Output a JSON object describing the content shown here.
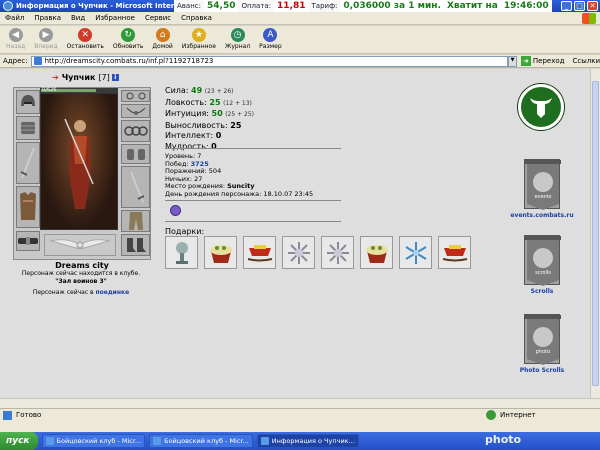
{
  "browser": {
    "title": "Информация о Чупчик - Microsoft Internet Explorer",
    "stats": [
      {
        "label": "Аванс:",
        "value": "54,50",
        "color": "green"
      },
      {
        "label": "Оплата:",
        "value": "11,81",
        "color": "red"
      },
      {
        "label": "Тариф:",
        "value": "0,036000 за 1 мин.",
        "color": "green"
      },
      {
        "label": "Хватит на",
        "value": "19:46:00",
        "color": "green"
      }
    ],
    "menu": [
      "Файл",
      "Правка",
      "Вид",
      "Избранное",
      "Сервис",
      "Справка"
    ],
    "toolbar": [
      {
        "label": "Назад",
        "icon": "back-arrow-icon",
        "enabled": false,
        "color": "#9a9a9a",
        "glyph": "◀"
      },
      {
        "label": "Вперед",
        "icon": "forward-arrow-icon",
        "enabled": false,
        "color": "#9a9a9a",
        "glyph": "▶"
      },
      {
        "label": "Остановить",
        "icon": "stop-icon",
        "enabled": true,
        "color": "#d23a2a",
        "glyph": "✕"
      },
      {
        "label": "Обновить",
        "icon": "refresh-icon",
        "enabled": true,
        "color": "#2e9a3a",
        "glyph": "↻"
      },
      {
        "label": "Домой",
        "icon": "home-icon",
        "enabled": true,
        "color": "#d47a1a",
        "glyph": "⌂"
      },
      {
        "label": "Избранное",
        "icon": "star-icon",
        "enabled": true,
        "color": "#e0b020",
        "glyph": "★"
      },
      {
        "label": "Журнал",
        "icon": "history-icon",
        "enabled": true,
        "color": "#2a8a5a",
        "glyph": "◷"
      },
      {
        "label": "Размер",
        "icon": "text-size-icon",
        "enabled": true,
        "color": "#3a5ac8",
        "glyph": "A"
      }
    ],
    "address_label": "Адрес:",
    "url": "http://dreamscity.combats.ru/inf.pl?1192718723",
    "go_label": "Переход",
    "links_label": "Ссылки",
    "status_text": "Готово",
    "zone_text": "Интернет",
    "ghost_url": "http://dreamscity.combats.ru/inf.pl?1192718723"
  },
  "character": {
    "name": "Чупчик",
    "level_tag": "[7]",
    "hp_text": "0/626",
    "stats": [
      {
        "label": "Сила:",
        "value": "49",
        "bonus": "(23 + 26)"
      },
      {
        "label": "Ловкость:",
        "value": "25",
        "bonus": "(12 + 13)"
      },
      {
        "label": "Интуиция:",
        "value": "50",
        "bonus": "(25 + 25)"
      },
      {
        "label": "Выносливость:",
        "value": "25",
        "bonus": ""
      },
      {
        "label": "Интеллект:",
        "value": "0",
        "bonus": ""
      },
      {
        "label": "Мудрость:",
        "value": "0",
        "bonus": ""
      }
    ],
    "info": [
      {
        "label": "Уровень:",
        "value": "7",
        "style": "plain"
      },
      {
        "label": "Побед:",
        "value": "3725",
        "style": "blue"
      },
      {
        "label": "Поражений:",
        "value": "504",
        "style": "plain"
      },
      {
        "label": "Ничьих:",
        "value": "27",
        "style": "plain"
      },
      {
        "label": "Место рождения:",
        "value": "Suncity",
        "style": "bold"
      },
      {
        "label": "День рождения персонажа:",
        "value": "18.10.07 23:45",
        "style": "plain"
      }
    ],
    "gifts_label": "Подарки:",
    "gifts": [
      "skull-cup-icon",
      "cake-icon",
      "sleigh-icon",
      "snowflake-icon",
      "snowflake-icon",
      "cake-icon",
      "snowflake-blue-icon",
      "sleigh-icon"
    ],
    "location_name": "Dreams city",
    "location_text": "Персонаж сейчас находится в клубе.",
    "location_room": "\"Зал воинов 3\"",
    "fight_prefix": "Персонаж сейчас в",
    "fight_link": "поединке"
  },
  "sidebar": {
    "banners": [
      {
        "label": "events.combats.ru",
        "title": "events"
      },
      {
        "label": "Scrolls",
        "title": "scrolls"
      },
      {
        "label": "Photo Scrolls",
        "title": "photo"
      }
    ]
  },
  "taskbar": {
    "start": "пуск",
    "tasks": [
      {
        "label": "Бойцовский клуб - Micr...",
        "active": false
      },
      {
        "label": "Бойцовский клуб - Micr...",
        "active": false
      },
      {
        "label": "Информация о Чупчик...",
        "active": true
      }
    ],
    "watermark": "photo"
  }
}
